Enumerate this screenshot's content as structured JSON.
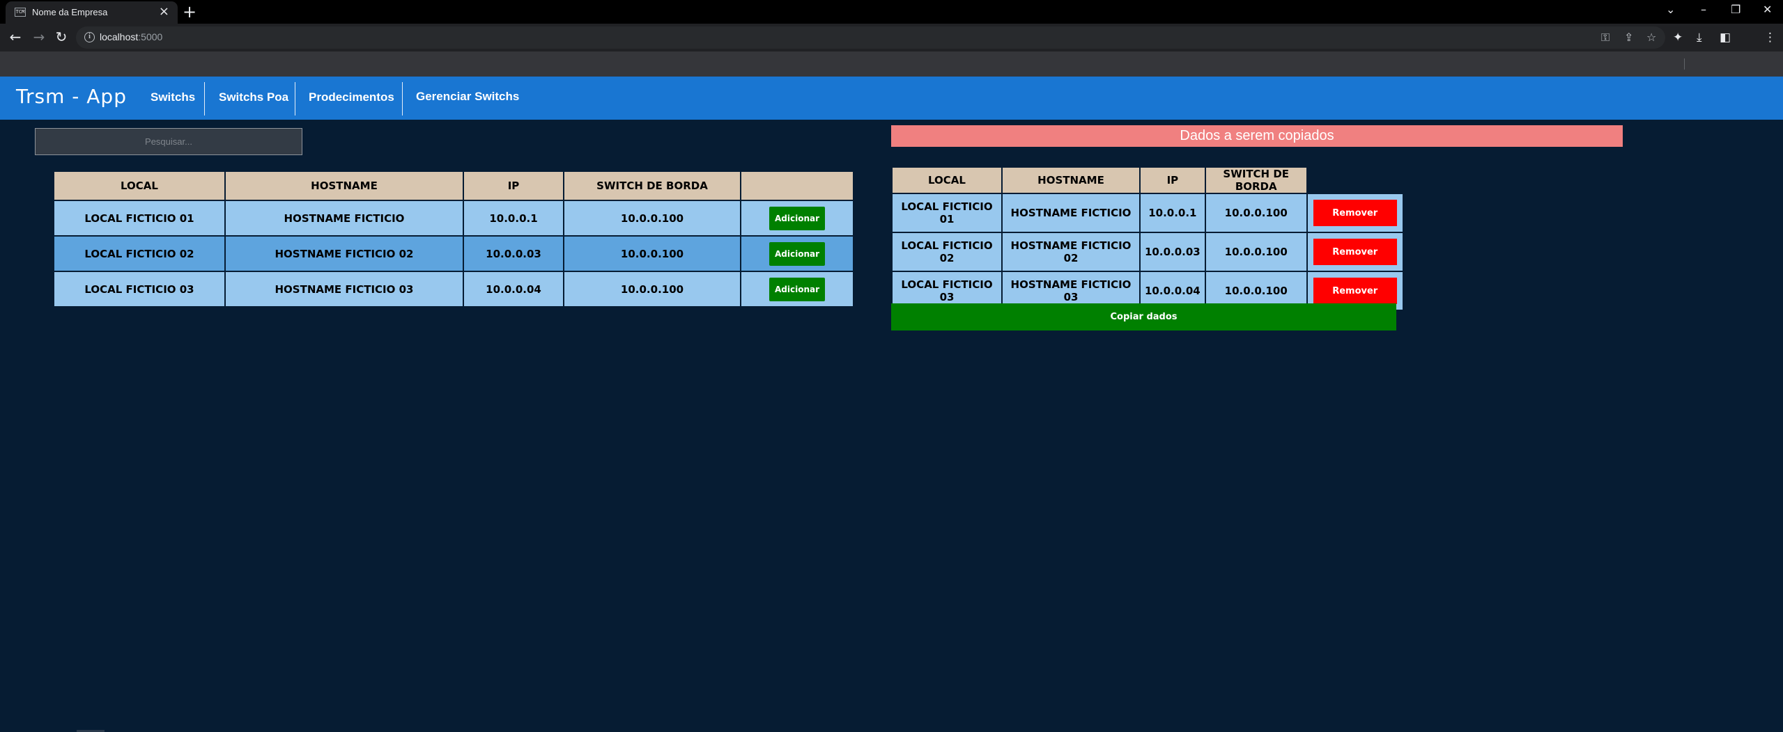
{
  "browser": {
    "tab_title": "Nome da Empresa",
    "favicon_text": "TCM",
    "url_host": "localhost",
    "url_port": ":5000"
  },
  "app": {
    "brand": "Trsm - App",
    "nav": [
      "Switchs",
      "Switchs Poa",
      "Prodecimentos",
      "Gerenciar Switchs"
    ]
  },
  "search": {
    "placeholder": "Pesquisar..."
  },
  "switches": {
    "headers": [
      "LOCAL",
      "HOSTNAME",
      "IP",
      "SWITCH DE BORDA",
      ""
    ],
    "add_label": "Adicionar",
    "rows": [
      {
        "local": "LOCAL FICTICIO 01",
        "hostname": "HOSTNAME FICTICIO",
        "ip": "10.0.0.1",
        "borda": "10.0.0.100"
      },
      {
        "local": "LOCAL FICTICIO 02",
        "hostname": "HOSTNAME FICTICIO 02",
        "ip": "10.0.0.03",
        "borda": "10.0.0.100"
      },
      {
        "local": "LOCAL FICTICIO 03",
        "hostname": "HOSTNAME FICTICIO 03",
        "ip": "10.0.0.04",
        "borda": "10.0.0.100"
      }
    ]
  },
  "copy_panel": {
    "banner": "Dados a serem copiados",
    "headers": [
      "LOCAL",
      "HOSTNAME",
      "IP",
      "SWITCH DE BORDA"
    ],
    "remove_label": "Remover",
    "copy_button": "Copiar dados",
    "rows": [
      {
        "local": "LOCAL FICTICIO 01",
        "hostname": "HOSTNAME FICTICIO",
        "ip": "10.0.0.1",
        "borda": "10.0.0.100"
      },
      {
        "local": "LOCAL FICTICIO 02",
        "hostname": "HOSTNAME FICTICIO 02",
        "ip": "10.0.0.03",
        "borda": "10.0.0.100"
      },
      {
        "local": "LOCAL FICTICIO 03",
        "hostname": "HOSTNAME FICTICIO 03",
        "ip": "10.0.0.04",
        "borda": "10.0.0.100"
      }
    ]
  },
  "colors": {
    "page_bg": "#061c33",
    "navbar": "#1976d2",
    "table_header": "#d8c6b0",
    "row_light": "#98c8ee",
    "row_dark": "#5ea4de",
    "add_button": "#008000",
    "remove_button": "#ff0000",
    "banner": "#f08080"
  }
}
